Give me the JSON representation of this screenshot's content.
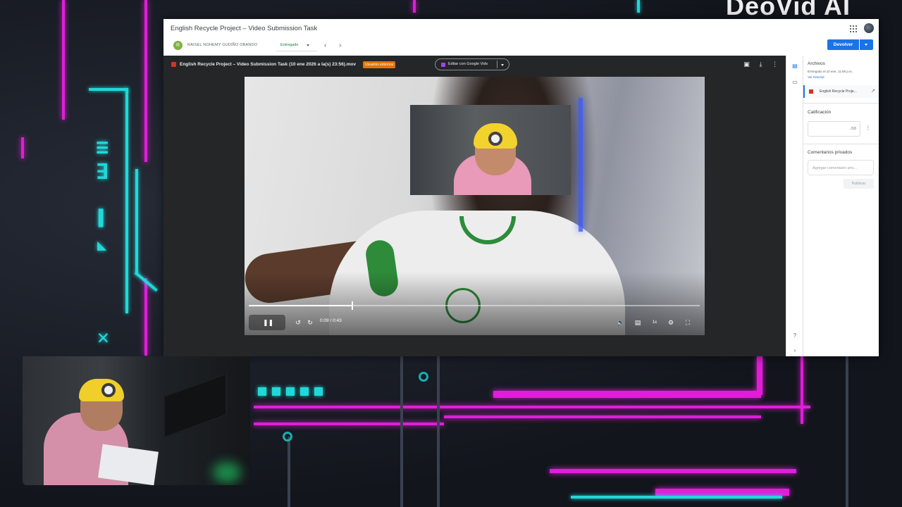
{
  "brand": {
    "text": "DeoVid AI"
  },
  "classroom": {
    "assignment_title": "English Recycle Project – Video Submission Task",
    "student": {
      "initial": "R",
      "name": "RAISEL NOHEMY GUDIÑO OBANDO",
      "status": "Entregado"
    },
    "return_button": "Devolver"
  },
  "viewer": {
    "file_name": "English Recycle Project – Video Submission Task (10 ene 2026 a la(s) 23:56).mov",
    "external_badge": "Usuarios externos",
    "edit_button": "Editar con Google Vids",
    "player": {
      "current_time": "0:09",
      "duration": "0:43",
      "time_display": "0:09 / 0:43",
      "progress": 0.23,
      "speed": "1x",
      "state": "playing"
    }
  },
  "side_panel": {
    "files_heading": "Archivos",
    "submitted_text": "Entregado el 10 ene, 11:58 p.m.",
    "history_link": "Ver historial",
    "attachment_label": "English Recycle Proje...",
    "grade_heading": "Calificación",
    "grade_max": "/10",
    "comments_heading": "Comentarios privados",
    "comment_placeholder": "Agregar comentario priv...",
    "post_button": "Publicar"
  },
  "colors": {
    "accent_blue": "#1a73e8",
    "overlay_magenta": "#e01ed8",
    "overlay_cyan": "#21d8d8",
    "status_green": "#188038",
    "badge_orange": "#e37400"
  }
}
